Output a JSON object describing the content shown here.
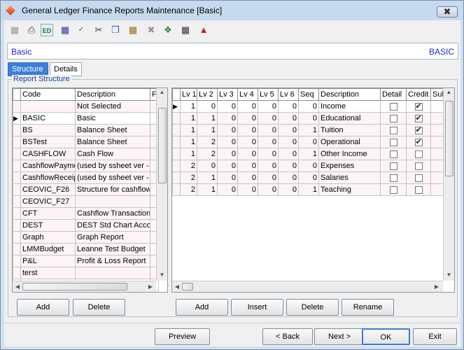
{
  "window": {
    "title": "General Ledger Finance Reports Maintenance  [Basic]",
    "close_glyph": "✖"
  },
  "toolbar": {
    "icons": [
      "save-icon",
      "print-icon",
      "edit-icon",
      "calculator-icon",
      "spellcheck-icon",
      "cut-icon",
      "copy-icon",
      "paste-icon",
      "delete-icon",
      "tree-icon",
      "grid-icon",
      "export-icon"
    ],
    "edit_label": "ED"
  },
  "infobar": {
    "left": "Basic",
    "right": "BASIC"
  },
  "tabs": [
    {
      "label": "Structure"
    },
    {
      "label": "Details"
    }
  ],
  "group_label": "Report Structure",
  "left_grid": {
    "columns": [
      "Code",
      "Description",
      "F"
    ],
    "rows": [
      {
        "code": "",
        "description": "Not Selected"
      },
      {
        "code": "BASIC",
        "description": "Basic"
      },
      {
        "code": "BS",
        "description": "Balance Sheet"
      },
      {
        "code": "BSTest",
        "description": "Balance Sheet"
      },
      {
        "code": "CASHFLOW",
        "description": "Cash Flow"
      },
      {
        "code": "CashflowPayme",
        "description": "(used by ssheet ver -"
      },
      {
        "code": "CashflowReceip",
        "description": "(used by ssheet ver -"
      },
      {
        "code": "CEOVIC_F26",
        "description": "Structure for cashflow"
      },
      {
        "code": "CEOVIC_F27",
        "description": ""
      },
      {
        "code": "CFT",
        "description": "Cashflow Transactiona"
      },
      {
        "code": "DEST",
        "description": "DEST Std Chart Accou"
      },
      {
        "code": "Graph",
        "description": "Graph Report"
      },
      {
        "code": "LMMBudget",
        "description": "Leanne Test Budget"
      },
      {
        "code": "P&L",
        "description": "Profit & Loss Report"
      },
      {
        "code": "terst",
        "description": ""
      }
    ],
    "selected_index": 1
  },
  "right_grid": {
    "columns": [
      "Lv 1",
      "Lv 2",
      "Lv 3",
      "Lv 4",
      "Lv 5",
      "Lv 6",
      "Seq",
      "Description",
      "Detail",
      "Credit",
      "Sub"
    ],
    "rows": [
      {
        "lv": [
          "1",
          "0",
          "0",
          "0",
          "0",
          "0"
        ],
        "seq": "0",
        "description": "Income",
        "detail": false,
        "credit": true
      },
      {
        "lv": [
          "1",
          "1",
          "0",
          "0",
          "0",
          "0"
        ],
        "seq": "0",
        "description": "Educational",
        "detail": false,
        "credit": true
      },
      {
        "lv": [
          "1",
          "1",
          "0",
          "0",
          "0",
          "0"
        ],
        "seq": "1",
        "description": "Tuition",
        "detail": false,
        "credit": true
      },
      {
        "lv": [
          "1",
          "2",
          "0",
          "0",
          "0",
          "0"
        ],
        "seq": "0",
        "description": "Operational",
        "detail": false,
        "credit": true
      },
      {
        "lv": [
          "1",
          "2",
          "0",
          "0",
          "0",
          "0"
        ],
        "seq": "1",
        "description": "Other Income",
        "detail": false,
        "credit": false
      },
      {
        "lv": [
          "2",
          "0",
          "0",
          "0",
          "0",
          "0"
        ],
        "seq": "0",
        "description": "Expenses",
        "detail": false,
        "credit": false
      },
      {
        "lv": [
          "2",
          "1",
          "0",
          "0",
          "0",
          "0"
        ],
        "seq": "0",
        "description": "Salaries",
        "detail": false,
        "credit": false
      },
      {
        "lv": [
          "2",
          "1",
          "0",
          "0",
          "0",
          "0"
        ],
        "seq": "1",
        "description": "Teaching",
        "detail": false,
        "credit": false
      }
    ]
  },
  "left_buttons": {
    "add": "Add",
    "delete": "Delete"
  },
  "right_buttons": {
    "add": "Add",
    "insert": "Insert",
    "delete": "Delete",
    "rename": "Rename"
  },
  "footer_buttons": {
    "preview": "Preview",
    "back": "< Back",
    "next": "Next >",
    "ok": "OK",
    "exit": "Exit"
  }
}
